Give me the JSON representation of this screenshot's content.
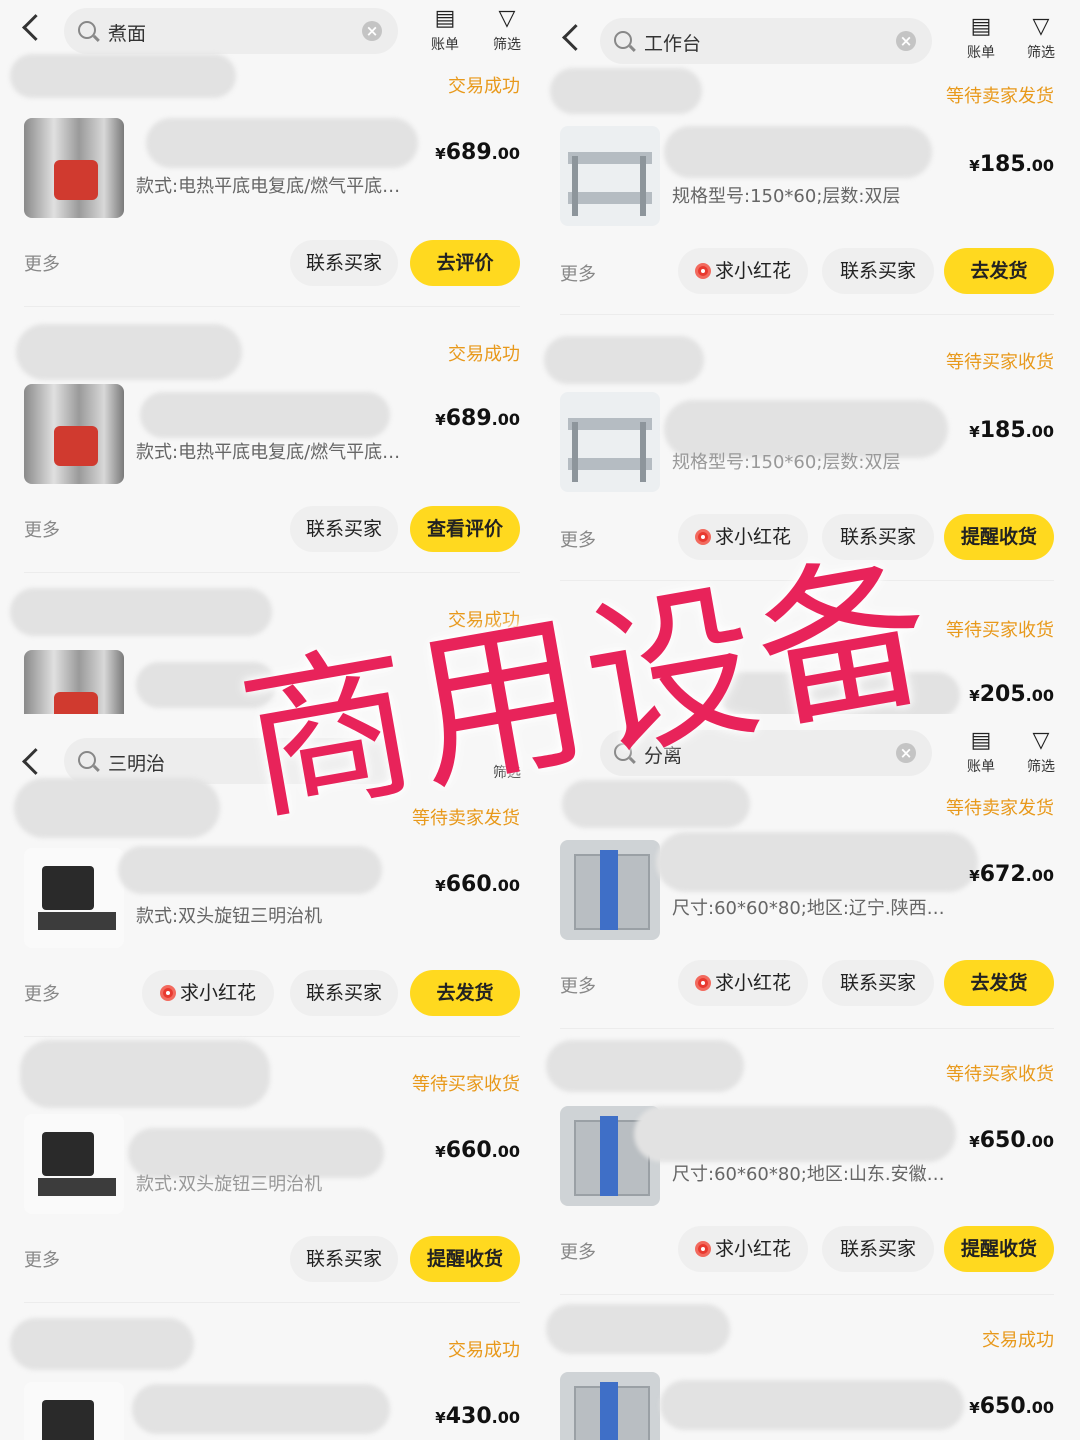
{
  "watermark": "商用设备",
  "header_labels": {
    "bill": "账单",
    "filter": "筛选",
    "back": ""
  },
  "common": {
    "more": "更多",
    "contact": "联系买家",
    "flower": "求小红花"
  },
  "panels": [
    {
      "search": "煮面",
      "orders": [
        {
          "status": "交易成功",
          "spec": "款式:电热平底电复底/燃气平底…",
          "price_int": "689",
          "price_dec": ".00",
          "action": "去评价",
          "thumb": "steamer"
        },
        {
          "status": "交易成功",
          "spec": "款式:电热平底电复底/燃气平底…",
          "price_int": "689",
          "price_dec": ".00",
          "action": "查看评价",
          "thumb": "steamer"
        },
        {
          "status": "交易成功",
          "thumb": "steamer"
        }
      ]
    },
    {
      "search": "工作台",
      "orders": [
        {
          "status": "等待卖家发货",
          "spec": "规格型号:150*60;层数:双层",
          "price_int": "185",
          "price_dec": ".00",
          "action": "去发货",
          "thumb": "table"
        },
        {
          "status": "等待买家收货",
          "spec": "规格型号:150*60;层数:双层",
          "price_int": "185",
          "price_dec": ".00",
          "action": "提醒收货",
          "thumb": "table"
        },
        {
          "status": "等待买家收货",
          "price_int": "205",
          "price_dec": ".00",
          "thumb": "table"
        }
      ]
    },
    {
      "search": "三明治",
      "orders": [
        {
          "status": "等待卖家发货",
          "spec": "款式:双头旋钮三明治机",
          "price_int": "660",
          "price_dec": ".00",
          "action": "去发货",
          "thumb": "waffle"
        },
        {
          "status": "等待买家收货",
          "spec": "款式:双头旋钮三明治机",
          "price_int": "660",
          "price_dec": ".00",
          "action": "提醒收货",
          "thumb": "waffle"
        },
        {
          "status": "交易成功",
          "price_int": "430",
          "price_dec": ".00",
          "thumb": "waffle"
        }
      ]
    },
    {
      "search": "分离",
      "orders": [
        {
          "status": "等待卖家发货",
          "spec": "尺寸:60*60*80;地区:辽宁.陕西…",
          "price_int": "672",
          "price_dec": ".00",
          "action": "去发货",
          "thumb": "separator"
        },
        {
          "status": "等待买家收货",
          "spec": "尺寸:60*60*80;地区:山东.安徽…",
          "price_int": "650",
          "price_dec": ".00",
          "action": "提醒收货",
          "thumb": "separator"
        },
        {
          "status": "交易成功",
          "price_int": "650",
          "price_dec": ".00",
          "thumb": "separator"
        }
      ]
    }
  ],
  "currency": "¥"
}
